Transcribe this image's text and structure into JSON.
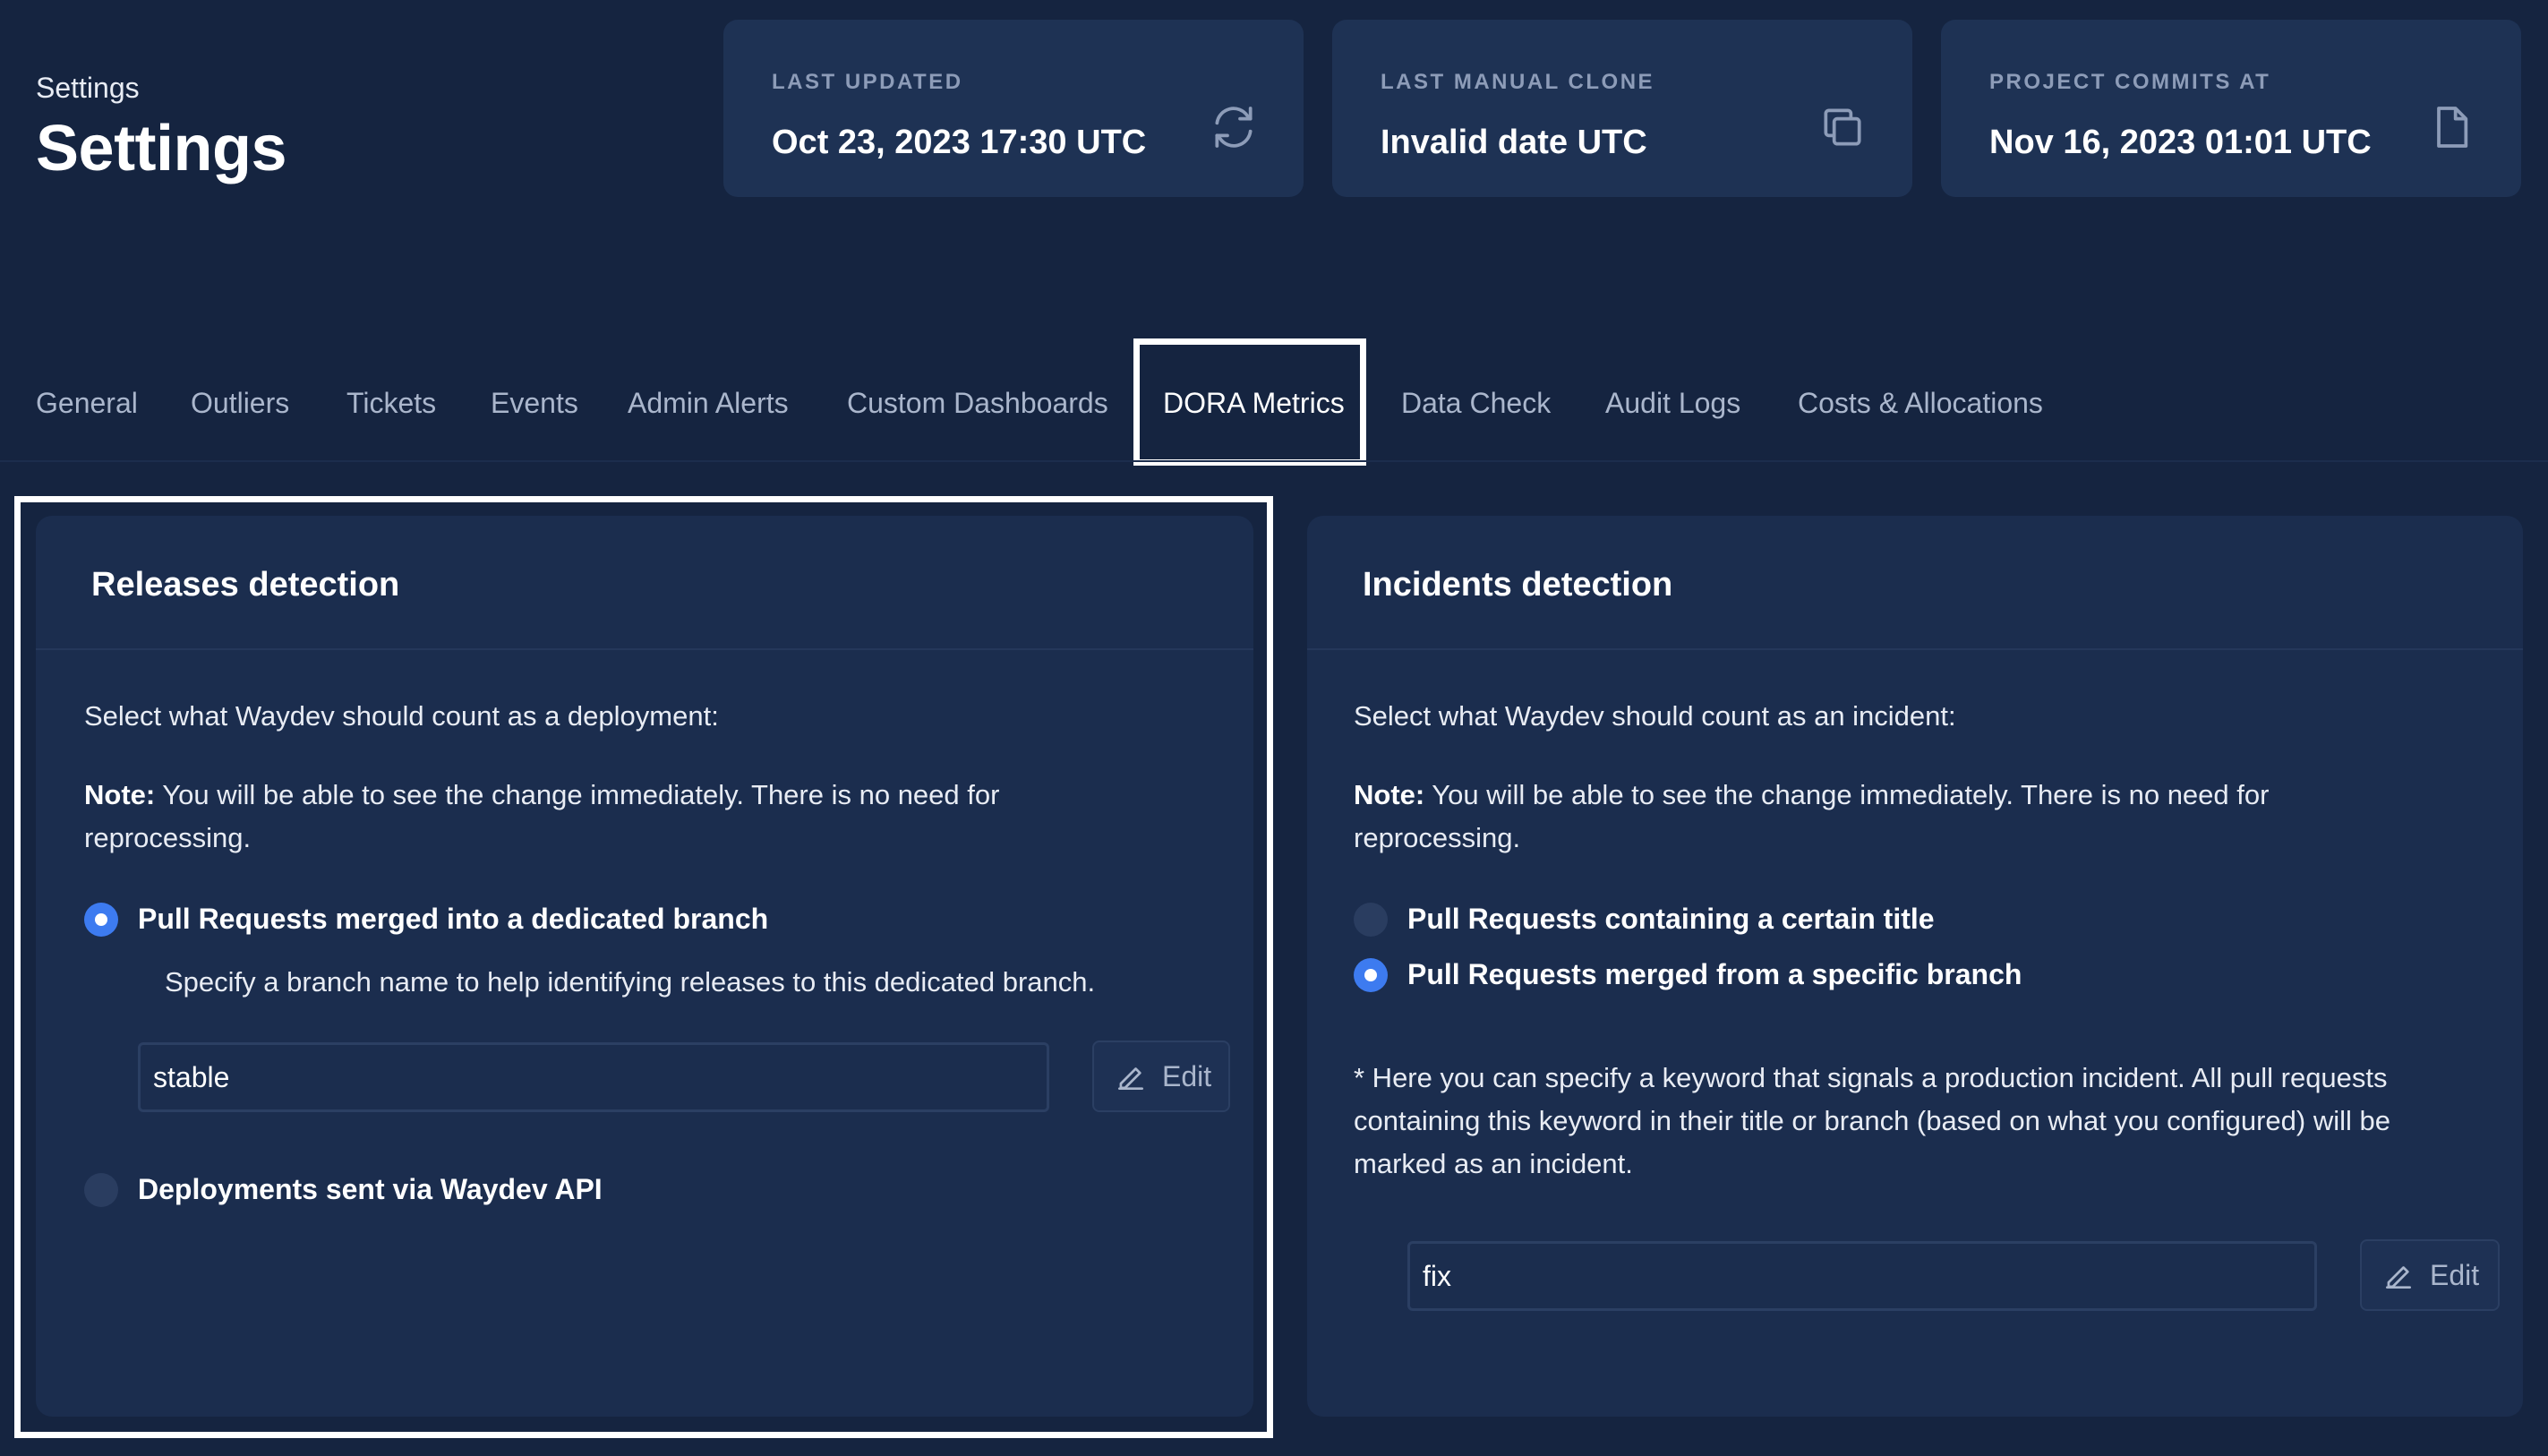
{
  "header": {
    "breadcrumb": "Settings",
    "title": "Settings"
  },
  "stats": [
    {
      "label": "LAST UPDATED",
      "value": "Oct 23, 2023 17:30 UTC",
      "icon": "refresh-icon"
    },
    {
      "label": "LAST MANUAL CLONE",
      "value": "Invalid date UTC",
      "icon": "copy-icon"
    },
    {
      "label": "PROJECT COMMITS AT",
      "value": "Nov 16, 2023 01:01 UTC",
      "icon": "file-icon"
    }
  ],
  "tabs": [
    "General",
    "Outliers",
    "Tickets",
    "Events",
    "Admin Alerts",
    "Custom Dashboards",
    "DORA Metrics",
    "Data Check",
    "Audit Logs",
    "Costs & Allocations"
  ],
  "active_tab": "DORA Metrics",
  "releases": {
    "title": "Releases detection",
    "prompt": "Select what Waydev should count as a deployment:",
    "note_label": "Note:",
    "note_text": " You will be able to see the change immediately. There is no need for reprocessing.",
    "option_branch": "Pull Requests merged into a dedicated branch",
    "option_branch_help": "Specify a branch name to help identifying releases to this dedicated branch.",
    "branch_value": "stable",
    "edit_label": "Edit",
    "option_api": "Deployments sent via Waydev API"
  },
  "incidents": {
    "title": "Incidents detection",
    "prompt": "Select what Waydev should count as an incident:",
    "note_label": "Note:",
    "note_text": " You will be able to see the change immediately. There is no need for reprocessing.",
    "option_title": "Pull Requests containing a certain title",
    "option_branch": "Pull Requests merged from a specific branch",
    "keyword_help": "* Here you can specify a keyword that signals a production incident. All pull requests containing this keyword in their title or branch (based on what you configured) will be marked as an incident.",
    "keyword_value": "fix",
    "edit_label": "Edit"
  },
  "colors": {
    "background": "#152440",
    "card": "#1e3254",
    "accent": "#3d7bf0"
  }
}
